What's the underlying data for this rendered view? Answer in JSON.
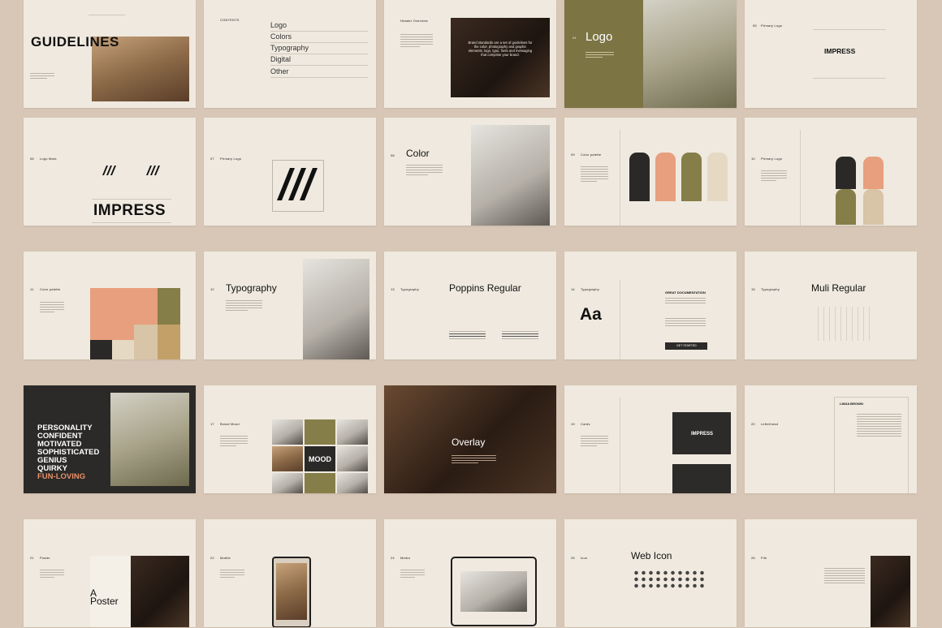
{
  "slides": {
    "s1": {
      "title": "GUIDELINES"
    },
    "s2": {
      "label": "CONTENTS",
      "items": [
        "Logo",
        "Colors",
        "Typography",
        "Digital",
        "Other"
      ]
    },
    "s3": {
      "label": "Header Overview",
      "text": "Brand standards are a set of guidelines for the color, photography and graphic elements, logo, typo, fonts and messaging that comprise your brand."
    },
    "s4": {
      "num": "04",
      "title": "Logo"
    },
    "s5": {
      "num": "05",
      "label": "Primary Logo",
      "wordmark": "IMPRESS"
    },
    "s6": {
      "num": "06",
      "label": "Logo Mark",
      "wordmark": "IMPRESS"
    },
    "s7": {
      "num": "07",
      "label": "Primary Logo"
    },
    "s8": {
      "num": "08",
      "title": "Color"
    },
    "s9": {
      "num": "09",
      "label": "Color palette"
    },
    "s10": {
      "num": "10",
      "label": "Primary Logo"
    },
    "s11": {
      "num": "11",
      "label": "Color palette"
    },
    "s12": {
      "num": "12",
      "title": "Typography"
    },
    "s13": {
      "num": "13",
      "label": "Typography",
      "title": "Poppins Regular"
    },
    "s14": {
      "num": "14",
      "label": "Typography",
      "glyph": "Aa",
      "heading": "GREAT DOCUMENTATION",
      "cta": "GET STARTED"
    },
    "s15": {
      "num": "15",
      "label": "Typography",
      "title": "Muli Regular"
    },
    "s16": {
      "words": [
        "PERSONALITY",
        "CONFIDENT",
        "MOTIVATED",
        "SOPHISTICATED",
        "GENIUS",
        "QUIRKY",
        "FUN-LOVING"
      ]
    },
    "s17": {
      "num": "17",
      "label": "Brand Mood",
      "mood": "MOOD"
    },
    "s18": {
      "title": "Overlay"
    },
    "s19": {
      "num": "19",
      "label": "Cards",
      "wordmark": "IMPRESS"
    },
    "s20": {
      "num": "20",
      "label": "Letterhead",
      "name": "LINDA BROWN"
    },
    "s21": {
      "num": "21",
      "label": "Poster",
      "title_a": "A",
      "title_b": "Poster"
    },
    "s22": {
      "num": "22",
      "label": "Mobile"
    },
    "s23": {
      "num": "24",
      "label": "Media"
    },
    "s24": {
      "num": "25",
      "label": "Icon",
      "title": "Web Icon"
    },
    "s25": {
      "num": "26",
      "label": "File"
    }
  },
  "colors": {
    "background": "#d8c7b6",
    "slide": "#efe9df",
    "dark": "#2a2927",
    "salmon": "#e79f7d",
    "olive": "#867e48",
    "sand": "#e6d9c4",
    "accent_orange": "#e8916a"
  }
}
